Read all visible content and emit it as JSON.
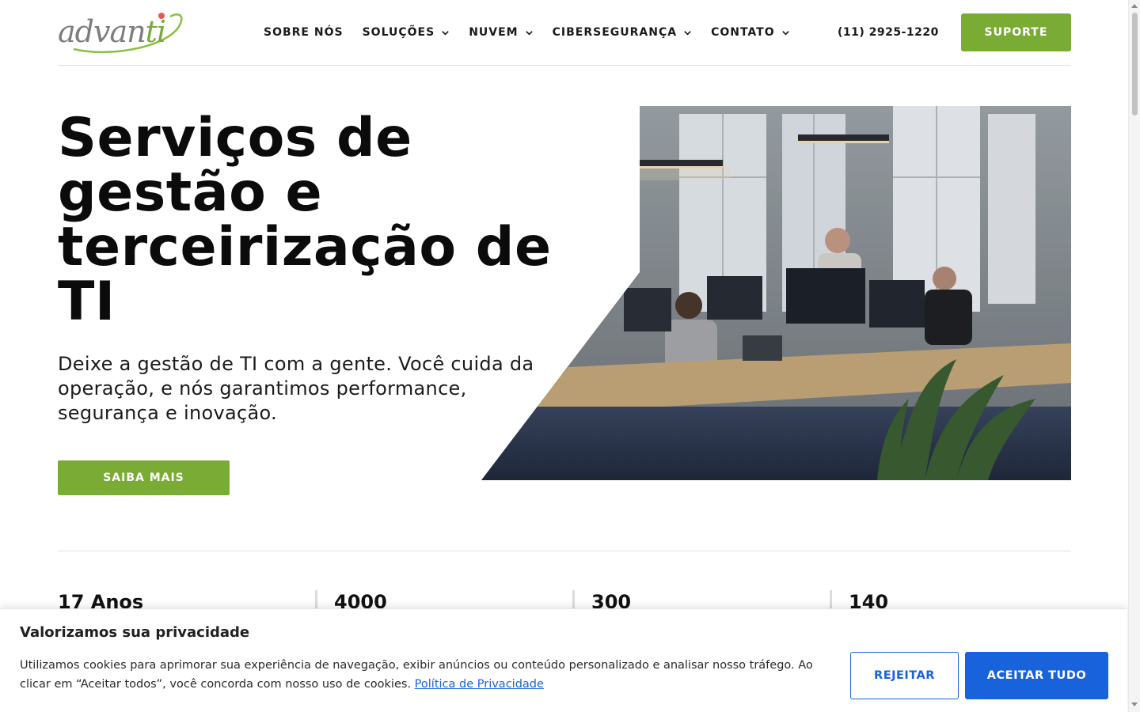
{
  "header": {
    "logo": {
      "text_main": "advan",
      "text_accent": "ti"
    },
    "nav": [
      {
        "label": "SOBRE NÓS",
        "has_dropdown": false
      },
      {
        "label": "SOLUÇÕES",
        "has_dropdown": true
      },
      {
        "label": "NUVEM",
        "has_dropdown": true
      },
      {
        "label": "CIBERSEGURANÇA",
        "has_dropdown": true
      },
      {
        "label": "CONTATO",
        "has_dropdown": true
      }
    ],
    "phone": "(11) 2925-1220",
    "support_label": "SUPORTE"
  },
  "hero": {
    "title": "Serviços de gestão e terceirização de TI",
    "subtitle": "Deixe a gestão de TI com a gente. Você cuida da operação, e nós garantimos performance, segurança e inovação.",
    "cta_label": "SAIBA MAIS"
  },
  "stats": [
    {
      "value": "17 Anos"
    },
    {
      "value": "4000"
    },
    {
      "value": "300"
    },
    {
      "value": "140"
    }
  ],
  "cookie_banner": {
    "title": "Valorizamos sua privacidade",
    "text": "Utilizamos cookies para aprimorar sua experiência de navegação, exibir anúncios ou conteúdo personalizado e analisar nosso tráfego. Ao clicar em “Aceitar todos”, você concorda com nosso uso de cookies. ",
    "link_label": "Política de Privacidade",
    "reject_label": "REJEITAR",
    "accept_label": "ACEITAR TUDO"
  },
  "colors": {
    "brand_green": "#7aac35",
    "cookie_blue": "#1863dc",
    "logo_gray": "#7d7d7d",
    "logo_red_dot": "#e05a5a"
  },
  "icons": {
    "dropdown": "chevron-down-icon",
    "hero_image": "office-team-photo"
  }
}
